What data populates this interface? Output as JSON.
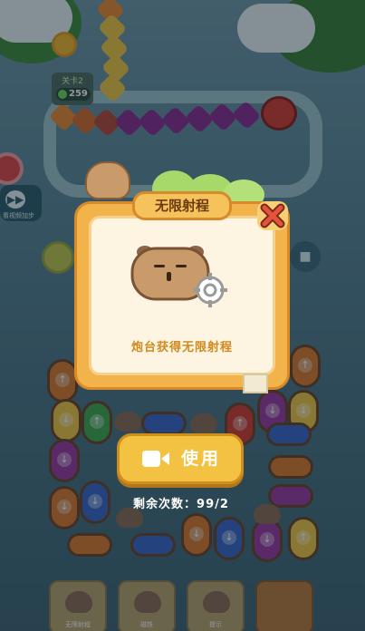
{
  "hud": {
    "level_label": "关卡2",
    "coins": "259",
    "side_button_label": "看视频加步"
  },
  "modal": {
    "title": "无限射程",
    "description": "炮台获得无限射程",
    "use_button_label": "使用",
    "remaining_label": "剩余次数：99/2"
  },
  "toolbar": {
    "tools": [
      {
        "label": "无限射程"
      },
      {
        "label": "磁铁"
      },
      {
        "label": "提示"
      },
      {
        "label": ""
      }
    ]
  },
  "colors": {
    "modal_bg": "#fdf4e2",
    "modal_frame": "#f2b34b",
    "button_yellow": "#f3c242",
    "caterpillar_purple": "#8a2c8f",
    "caterpillar_red": "#d23b2d",
    "caterpillar_yellow": "#f0c640"
  },
  "icons": {
    "close": "close-x-icon",
    "video": "video-camera-icon",
    "crosshair": "crosshair-icon",
    "settings": "gear-icon",
    "fast_forward": "fast-forward-icon",
    "coin": "coin-icon"
  }
}
